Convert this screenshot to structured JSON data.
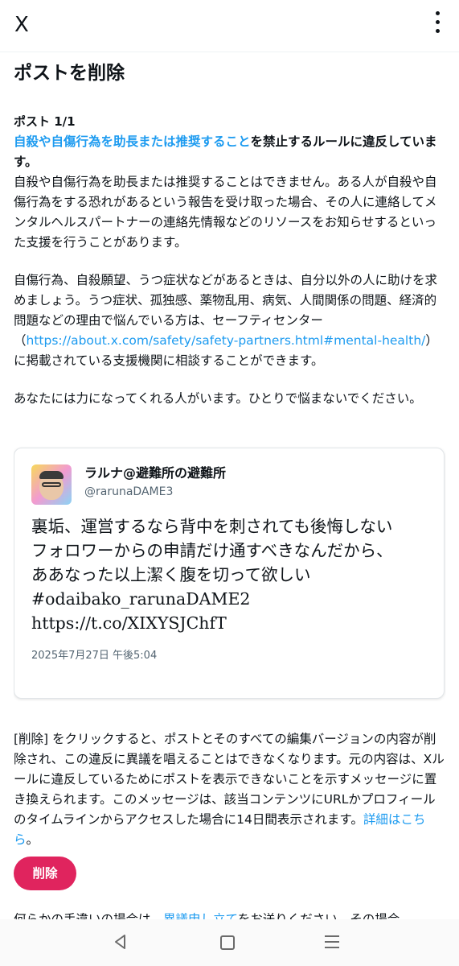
{
  "header": {
    "close_label": "X"
  },
  "page": {
    "title": "ポストを削除",
    "post_count": "ポスト 1/1",
    "rule_link": "自殺や自傷行為を助長または推奨すること",
    "rule_suffix": "を禁止するルールに違反しています。",
    "para1": "自殺や自傷行為を助長または推奨することはできません。ある人が自殺や自傷行為をする恐れがあるという報告を受け取った場合、その人に連絡してメンタルヘルスパートナーの連絡先情報などのリソースをお知らせするといった支援を行うことがあります。",
    "para2_before": "自傷行為、自殺願望、うつ症状などがあるときは、自分以外の人に助けを求めましょう。うつ症状、孤独感、薬物乱用、病気、人間関係の問題、経済的問題などの理由で悩んでいる方は、セーフティセンター（",
    "para2_link": "https://about.x.com/safety/safety-partners.html#mental-health/",
    "para2_after": "）に掲載されている支援機関に相談することができます。",
    "para3": "あなたには力になってくれる人がいます。ひとりで悩まないでください。"
  },
  "post": {
    "display_name": "ラルナ@避難所の避難所",
    "handle": "@rarunaDAME3",
    "text_lines": [
      "裏垢、運営するなら背中を刺されても後悔しない",
      "フォロワーからの申請だけ通すべきなんだから、",
      "ああなった以上潔く腹を切って欲しい",
      "#odaibako_rarunaDAME2",
      "https://t.co/XIXYSJChfT"
    ],
    "timestamp": "2025年7月27日 午後5:04"
  },
  "notice": {
    "text": "[削除] をクリックすると、ポストとそのすべての編集バージョンの内容が削除され、この違反に異議を唱えることはできなくなります。元の内容は、Xルールに違反しているためにポストを表示できないことを示すメッセージに置き換えられます。このメッセージは、該当コンテンツにURLかプロフィールのタイムラインからアクセスした場合に14日間表示されます。",
    "details_link": "詳細はこちら",
    "details_suffix": "。"
  },
  "delete_button_label": "削除",
  "cutoff": {
    "before": "何らかの手違いの場合は、",
    "link": "異議申し立て",
    "after": "をお送りください。その場合"
  },
  "colors": {
    "link": "#1d9bf0",
    "delete_button": "#e0245e",
    "text": "#0f1419",
    "secondary": "#536471"
  }
}
